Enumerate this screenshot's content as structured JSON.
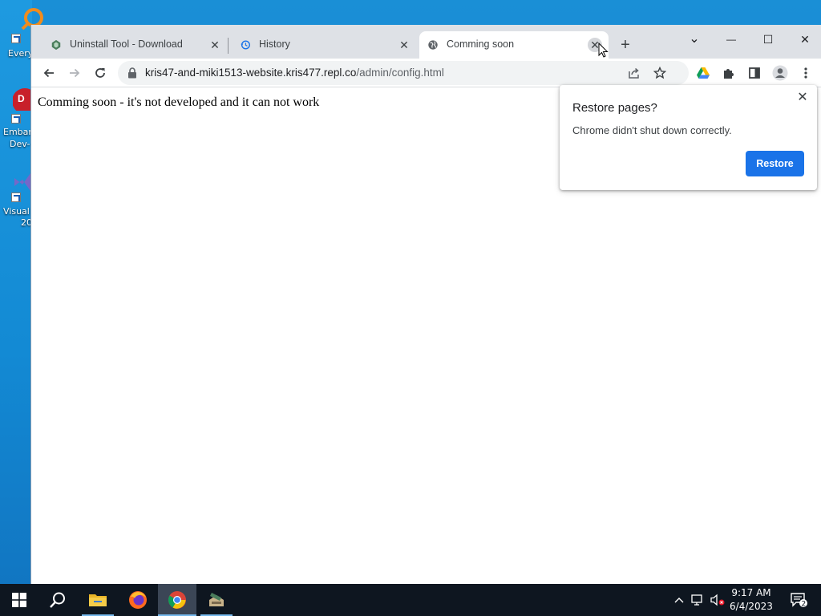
{
  "desktop": {
    "icons": [
      {
        "label": "Every",
        "name": "everything-icon"
      },
      {
        "label": "Embar",
        "label2": "Dev-",
        "name": "embarcadero-dev-icon"
      },
      {
        "label": "Visual",
        "label2": "20",
        "name": "visual-studio-icon"
      }
    ]
  },
  "tabs": [
    {
      "title": "Uninstall Tool - Download",
      "close": "✕"
    },
    {
      "title": "History",
      "close": "✕"
    },
    {
      "title": "Comming soon",
      "close": "✕"
    }
  ],
  "new_tab": "+",
  "window_controls": {
    "minimize": "—",
    "maximize": "☐",
    "close": "✕",
    "tab_search": "⌄"
  },
  "address_bar": {
    "host": "kris47-and-miki1513-website.kris477.repl.co",
    "path": "/admin/config.html"
  },
  "page": {
    "text": "Comming soon - it's not developed and it can not work"
  },
  "restore_bubble": {
    "title": "Restore pages?",
    "message": "Chrome didn't shut down correctly.",
    "button": "Restore",
    "close": "✕"
  },
  "taskbar": {
    "time": "9:17 AM",
    "date": "6/4/2023",
    "notification_count": "2"
  },
  "colors": {
    "accent": "#1a73e8",
    "desktop": "#1a8fd6",
    "taskbar": "#0e1620"
  }
}
